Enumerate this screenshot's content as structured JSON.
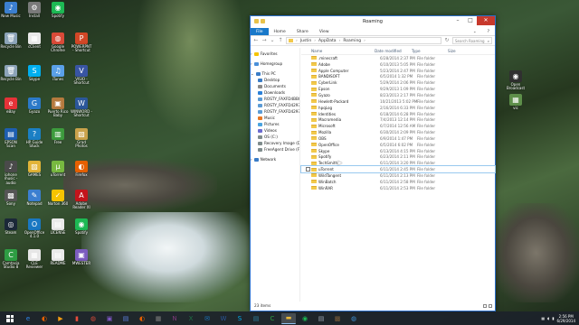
{
  "window": {
    "title": "Roaming",
    "ribbon_tabs": [
      "File",
      "Home",
      "Share",
      "View"
    ],
    "path": [
      "Justin",
      "AppData",
      "Roaming"
    ],
    "search_placeholder": "Search Roaming",
    "nav": {
      "favorites": "Favorites",
      "homegroup": "Homegroup",
      "thispc": "This PC",
      "pc_items": [
        "Desktop",
        "Documents",
        "Downloads",
        "ROSTY_FAXFD4BB08",
        "ROSTY_FAXFD4297E",
        "ROSTY_FAXFD42979",
        "Music",
        "Pictures",
        "Videos",
        "OS (C:)",
        "Recovery Image (D:)",
        "FreeAgent Drive (F:)"
      ],
      "network": "Network"
    },
    "columns": {
      "name": "Name",
      "date": "Date modified",
      "type": "Type",
      "size": "Size"
    },
    "rows": [
      {
        "name": ".minecraft",
        "date": "6/28/2014 2:37 PM",
        "type": "File folder"
      },
      {
        "name": "Adobe",
        "date": "6/10/2013 5:05 PM",
        "type": "File folder"
      },
      {
        "name": "Apple Computer",
        "date": "5/23/2014 2:47 PM",
        "type": "File folder"
      },
      {
        "name": "BANDISOFT",
        "date": "6/5/2014 1:32 PM",
        "type": "File folder"
      },
      {
        "name": "CyberLink",
        "date": "5/29/2014 2:06 PM",
        "type": "File folder"
      },
      {
        "name": "Epson",
        "date": "9/29/2013 1:09 PM",
        "type": "File folder"
      },
      {
        "name": "Gyazo",
        "date": "8/23/2013 2:17 PM",
        "type": "File folder"
      },
      {
        "name": "Hewlett-Packard",
        "date": "10/21/2013 5:02 PM",
        "type": "File folder"
      },
      {
        "name": "hpqLog",
        "date": "2/16/2014 6:33 PM",
        "type": "File folder"
      },
      {
        "name": "Identities",
        "date": "6/18/2014 6:28 PM",
        "type": "File folder"
      },
      {
        "name": "Macromedia",
        "date": "7/4/2013 12:14 PM",
        "type": "File folder"
      },
      {
        "name": "Microsoft",
        "date": "6/7/2014 12:56 AM",
        "type": "File folder"
      },
      {
        "name": "Mozilla",
        "date": "6/30/2014 2:09 PM",
        "type": "File folder"
      },
      {
        "name": "OBS",
        "date": "6/9/2014 1:47 PM",
        "type": "File folder"
      },
      {
        "name": "OpenOffice",
        "date": "6/5/2014 6:02 PM",
        "type": "File folder"
      },
      {
        "name": "Skype",
        "date": "6/13/2014 4:15 PM",
        "type": "File folder"
      },
      {
        "name": "Spotify",
        "date": "6/23/2014 2:11 PM",
        "type": "File folder"
      },
      {
        "name": "TechSmith",
        "date": "6/11/2014 3:20 PM",
        "type": "File folder"
      },
      {
        "name": "uTorrent",
        "date": "6/11/2014 2:45 PM",
        "type": "File folder"
      },
      {
        "name": "WildTangent",
        "date": "6/11/2014 2:13 PM",
        "type": "File folder"
      },
      {
        "name": "WinBatch",
        "date": "6/11/2014 2:58 PM",
        "type": "File folder"
      },
      {
        "name": "WinRAR",
        "date": "6/11/2014 2:53 PM",
        "type": "File folder"
      }
    ],
    "selected_row": 18,
    "status": "23 items"
  },
  "desktop_icons": [
    {
      "label": "New Music",
      "color": "#3c7fd0",
      "glyph": "♪"
    },
    {
      "label": "Install",
      "color": "#7a7a7a",
      "glyph": "⚙"
    },
    {
      "label": "Spotify",
      "color": "#1db954",
      "glyph": "◉"
    },
    {
      "label": "Recycle Bin",
      "color": "#8ca3b8",
      "glyph": "🗑"
    },
    {
      "label": "cClient",
      "color": "#e9e9e9",
      "glyph": "▦"
    },
    {
      "label": "Google Chrome",
      "color": "#d94a38",
      "glyph": "◍"
    },
    {
      "label": "POWERPNT - Shortcut",
      "color": "#d24726",
      "glyph": "P"
    },
    {
      "label": "Recycle Bin",
      "color": "#8ca3b8",
      "glyph": "🗑"
    },
    {
      "label": "Skype",
      "color": "#00aff0",
      "glyph": "S"
    },
    {
      "label": "iTunes",
      "color": "#5aa0e8",
      "glyph": "♫"
    },
    {
      "label": "VISIO - Shortcut",
      "color": "#3955a3",
      "glyph": "V"
    },
    {
      "label": "eBay",
      "color": "#e53238",
      "glyph": "e"
    },
    {
      "label": "Gyazo",
      "color": "#2b79c8",
      "glyph": "G"
    },
    {
      "label": "Puerto Rico Baby",
      "color": "#b57a3e",
      "glyph": "▣"
    },
    {
      "label": "WINWORD - Shortcut",
      "color": "#2b579a",
      "glyph": "W"
    },
    {
      "label": "EPSON Scan",
      "color": "#1e5fb0",
      "glyph": "▤"
    },
    {
      "label": "HP Guide Stuck",
      "color": "#1b7fc4",
      "glyph": "?"
    },
    {
      "label": "Free",
      "color": "#3d9b3d",
      "glyph": "▥"
    },
    {
      "label": "Grad Photos",
      "color": "#c9a24b",
      "glyph": "▧"
    },
    {
      "label": "iphone music - audio",
      "color": "#4a4a4a",
      "glyph": "♪"
    },
    {
      "label": "GAMES",
      "color": "#e2b438",
      "glyph": "▨"
    },
    {
      "label": "uTorrent",
      "color": "#78b940",
      "glyph": "µ"
    },
    {
      "label": "Firefox",
      "color": "#e66000",
      "glyph": "◐"
    },
    {
      "label": "Sony",
      "color": "#555",
      "glyph": "▩"
    },
    {
      "label": "Notepad",
      "color": "#3c7fd0",
      "glyph": "✎"
    },
    {
      "label": "Norton 360",
      "color": "#f5c400",
      "glyph": "✓"
    },
    {
      "label": "Adobe Reader XI",
      "color": "#c3141b",
      "glyph": "A"
    },
    {
      "label": "Steam",
      "color": "#1b2838",
      "glyph": "◎"
    },
    {
      "label": "OpenOffice 4.1.0",
      "color": "#1a78c2",
      "glyph": "O"
    },
    {
      "label": "LICENSE",
      "color": "#eaeaea",
      "glyph": "▤"
    },
    {
      "label": "Spotify",
      "color": "#1db954",
      "glyph": "◉"
    },
    {
      "label": "Camtasia Studio 8",
      "color": "#2e9d43",
      "glyph": "C"
    },
    {
      "label": "CLE Reviewer",
      "color": "#e6e6e6",
      "glyph": "▦"
    },
    {
      "label": "README",
      "color": "#eaeaea",
      "glyph": "▤"
    },
    {
      "label": "MWESTER",
      "color": "#7c5cbf",
      "glyph": "▣"
    },
    {
      "label": "Open Broadcast",
      "color": "#303030",
      "glyph": "◉"
    },
    {
      "label": "vic",
      "color": "#5e8f4a",
      "glyph": "▦"
    }
  ],
  "taskbar": {
    "apps": [
      {
        "name": "Internet Explorer",
        "glyph": "e",
        "color": "#2d89ef"
      },
      {
        "name": "Firefox",
        "glyph": "◐",
        "color": "#e66000"
      },
      {
        "name": "Media Player",
        "glyph": "▶",
        "color": "#f39c12"
      },
      {
        "name": "Stats",
        "glyph": "▮",
        "color": "#e74c3c"
      },
      {
        "name": "Chrome",
        "glyph": "◍",
        "color": "#d94a38"
      },
      {
        "name": "Photo",
        "glyph": "▣",
        "color": "#7e57c2"
      },
      {
        "name": "Gallery",
        "glyph": "▤",
        "color": "#5b7dd8"
      },
      {
        "name": "Firefox 2",
        "glyph": "◐",
        "color": "#e66000"
      },
      {
        "name": "Calculator",
        "glyph": "▦",
        "color": "#7c7c7c"
      },
      {
        "name": "OneNote",
        "glyph": "N",
        "color": "#80397b"
      },
      {
        "name": "Excel",
        "glyph": "X",
        "color": "#1e7145"
      },
      {
        "name": "Mail",
        "glyph": "✉",
        "color": "#1a78c2"
      },
      {
        "name": "Word",
        "glyph": "W",
        "color": "#2b579a"
      },
      {
        "name": "Skype",
        "glyph": "S",
        "color": "#00aff0"
      },
      {
        "name": "Store",
        "glyph": "▤",
        "color": "#2d7d9a"
      },
      {
        "name": "Camtasia",
        "glyph": "C",
        "color": "#2e9d43"
      },
      {
        "name": "Explorer",
        "glyph": "▬",
        "color": "#e8b838"
      },
      {
        "name": "Spotify",
        "glyph": "◉",
        "color": "#1db954"
      },
      {
        "name": "Notepad",
        "glyph": "▤",
        "color": "#9aa5b1"
      },
      {
        "name": "Minecraft",
        "glyph": "▩",
        "color": "#7b5d3a"
      },
      {
        "name": "Browser",
        "glyph": "◍",
        "color": "#3f8fd2"
      }
    ],
    "time": "2:56 PM",
    "date": "6/29/2014"
  }
}
